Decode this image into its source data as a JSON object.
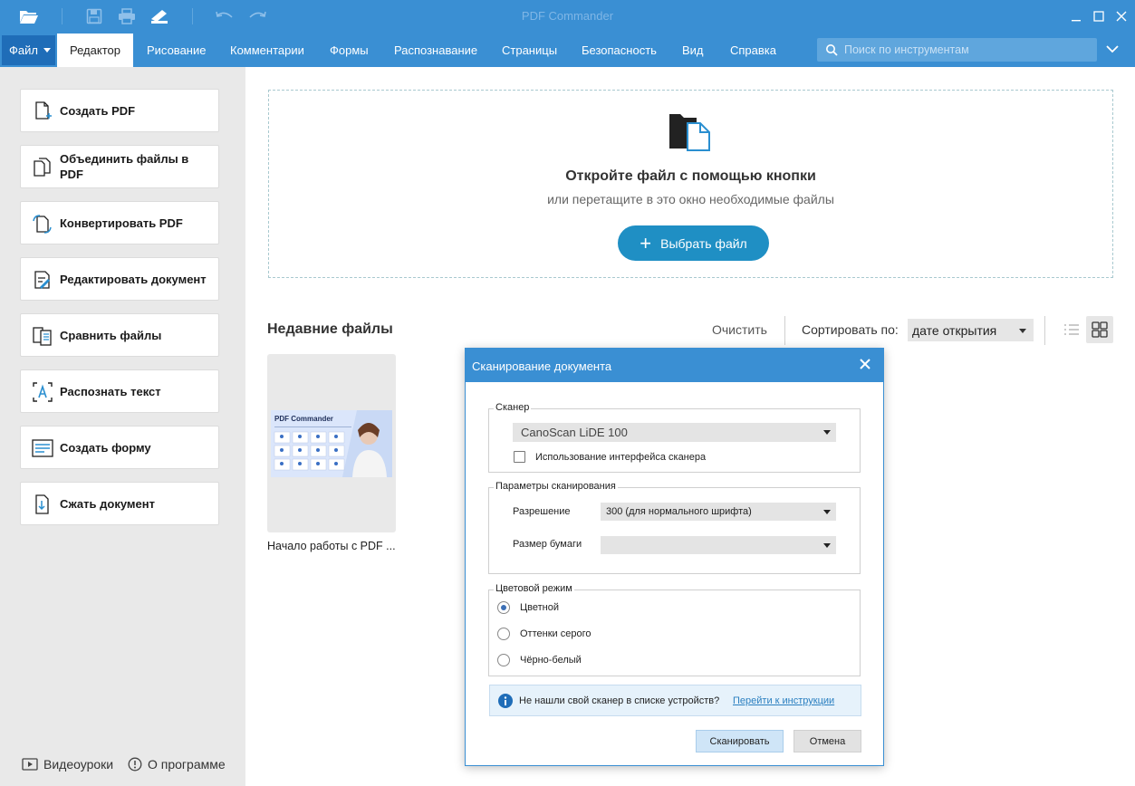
{
  "app": {
    "title": "PDF Commander"
  },
  "menu": {
    "file_label": "Файл",
    "tabs": [
      "Редактор",
      "Рисование",
      "Комментарии",
      "Формы",
      "Распознавание",
      "Страницы",
      "Безопасность",
      "Вид",
      "Справка"
    ],
    "active_tab": "Редактор"
  },
  "search": {
    "placeholder": "Поиск по инструментам"
  },
  "tools": [
    {
      "label": "Создать PDF",
      "icon": "create-pdf-icon"
    },
    {
      "label": "Объединить файлы в PDF",
      "icon": "merge-files-icon"
    },
    {
      "label": "Конвертировать PDF",
      "icon": "convert-pdf-icon"
    },
    {
      "label": "Редактировать документ",
      "icon": "edit-document-icon"
    },
    {
      "label": "Сравнить файлы",
      "icon": "compare-files-icon"
    },
    {
      "label": "Распознать текст",
      "icon": "ocr-icon"
    },
    {
      "label": "Создать форму",
      "icon": "form-icon"
    },
    {
      "label": "Сжать документ",
      "icon": "compress-icon"
    }
  ],
  "footer": {
    "video_label": "Видеоуроки",
    "about_label": "О программе"
  },
  "dropzone": {
    "title": "Откройте файл с помощью кнопки",
    "subtitle": "или перетащите в это окно необходимые файлы",
    "button_label": "Выбрать файл"
  },
  "recent": {
    "title": "Недавние файлы",
    "clear_label": "Очистить",
    "sort_label": "Сортировать по:",
    "sort_value": "дате открытия",
    "files": [
      {
        "name": "Начало работы с PDF ...",
        "thumb_title": "PDF Commander"
      }
    ]
  },
  "dialog": {
    "title": "Сканирование документа",
    "scanner_group": "Сканер",
    "scanner_value": "CanoScan LiDE 100",
    "use_interface_label": "Использование интерфейса сканера",
    "use_interface_checked": false,
    "params_group": "Параметры сканирования",
    "resolution_label": "Разрешение",
    "resolution_value": "300 (для нормального шрифта)",
    "paper_label": "Размер бумаги",
    "paper_value": "",
    "color_group": "Цветовой режим",
    "color_options": [
      "Цветной",
      "Оттенки серого",
      "Чёрно-белый"
    ],
    "color_selected": "Цветной",
    "info_text": "Не нашли свой сканер в списке устройств?",
    "info_link": "Перейти к инструкции",
    "scan_button": "Сканировать",
    "cancel_button": "Отмена"
  },
  "colors": {
    "accent": "#3a8fd3",
    "file_menu": "#1f6db8",
    "primary_button": "#1f8fc4",
    "panel_bg": "#e9e9e9"
  }
}
